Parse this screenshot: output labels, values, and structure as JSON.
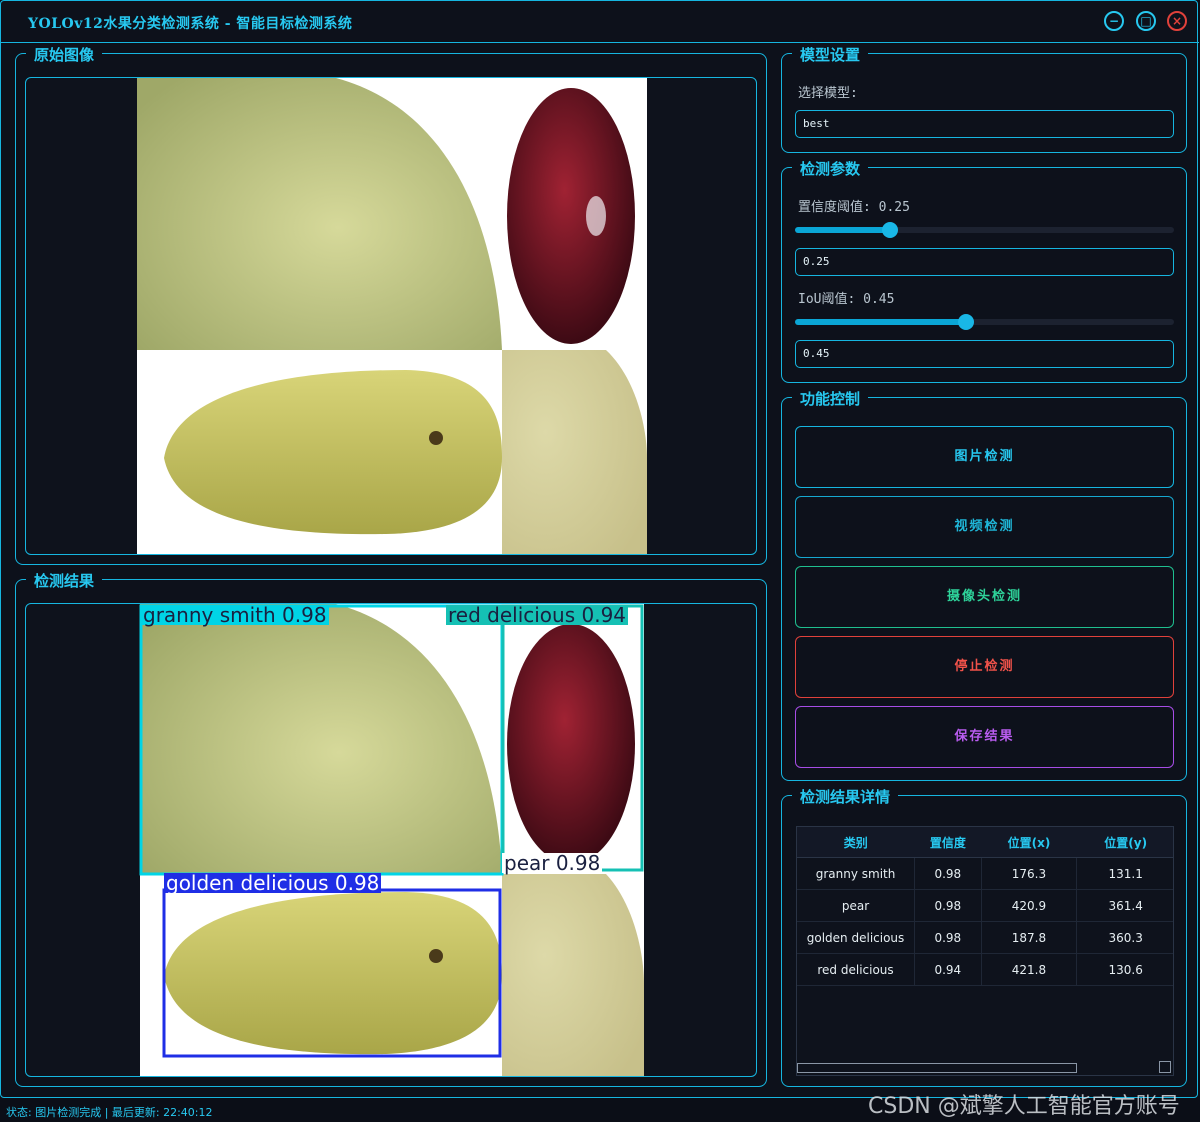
{
  "window": {
    "title": "YOLOv12水果分类检测系统 - 智能目标检测系统",
    "min_icon": "−",
    "max_icon": "□",
    "close_icon": "×"
  },
  "panels": {
    "original_title": "原始图像",
    "result_title": "检测结果"
  },
  "detections_overlay": [
    {
      "label": "granny smith 0.98",
      "color": "#00d4e6"
    },
    {
      "label": "red delicious 0.94",
      "color": "#15c0b4"
    },
    {
      "label": "golden delicious 0.98",
      "color": "#1f2ee6"
    },
    {
      "label": "pear 0.98",
      "color": "#ffffff"
    }
  ],
  "model": {
    "group_title": "模型设置",
    "select_label": "选择模型:",
    "selected": "best"
  },
  "params": {
    "group_title": "检测参数",
    "conf_label": "置信度阈值: 0.25",
    "conf_value": "0.25",
    "conf_level": 0.25,
    "iou_label": "IoU阈值: 0.45",
    "iou_value": "0.45",
    "iou_level": 0.45
  },
  "controls": {
    "group_title": "功能控制",
    "image_detect": "图片检测",
    "video_detect": "视频检测",
    "camera_detect": "摄像头检测",
    "stop_detect": "停止检测",
    "save_results": "保存结果"
  },
  "results": {
    "group_title": "检测结果详情",
    "columns": [
      "类别",
      "置信度",
      "位置(x)",
      "位置(y)"
    ],
    "rows": [
      [
        "granny smith",
        "0.98",
        "176.3",
        "131.1"
      ],
      [
        "pear",
        "0.98",
        "420.9",
        "361.4"
      ],
      [
        "golden delicious",
        "0.98",
        "187.8",
        "360.3"
      ],
      [
        "red delicious",
        "0.94",
        "421.8",
        "130.6"
      ]
    ]
  },
  "status_text": "状态: 图片检测完成 | 最后更新: 22:40:12",
  "watermark": "CSDN @斌擎人工智能官方账号",
  "colors": {
    "accent": "#16b6e0",
    "camera_border": "#1fbf8f",
    "stop_border": "#e0413b",
    "save_border": "#a64de6"
  }
}
